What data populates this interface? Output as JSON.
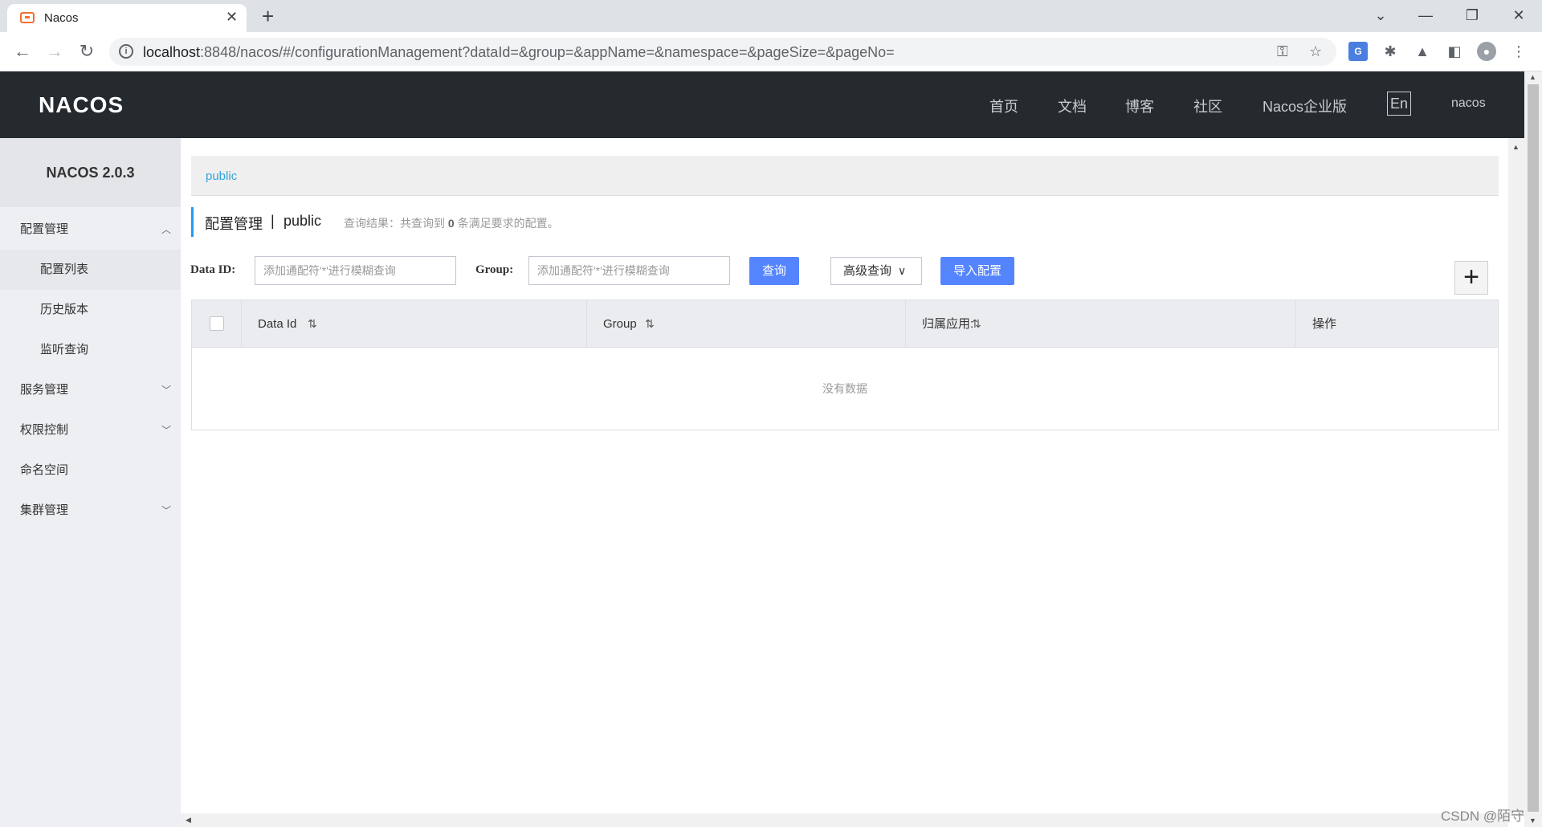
{
  "browser": {
    "tab_title": "Nacos",
    "url_host": "localhost",
    "url_rest": ":8848/nacos/#/configurationManagement?dataId=&group=&appName=&namespace=&pageSize=&pageNo="
  },
  "header": {
    "logo": "NACOS",
    "nav": [
      "首页",
      "文档",
      "博客",
      "社区",
      "Nacos企业版"
    ],
    "lang": "En",
    "user": "nacos"
  },
  "sidebar": {
    "version": "NACOS 2.0.3",
    "items": [
      {
        "label": "配置管理"
      },
      {
        "label": "配置列表"
      },
      {
        "label": "历史版本"
      },
      {
        "label": "监听查询"
      },
      {
        "label": "服务管理"
      },
      {
        "label": "权限控制"
      },
      {
        "label": "命名空间"
      },
      {
        "label": "集群管理"
      }
    ]
  },
  "main": {
    "namespace_tab": "public",
    "title": "配置管理",
    "separator": "|",
    "namespace": "public",
    "query_result_prefix": "查询结果：共查询到",
    "query_result_count": "0",
    "query_result_suffix": "条满足要求的配置。",
    "dataid_label": "Data ID:",
    "dataid_placeholder": "添加通配符'*'进行模糊查询",
    "group_label": "Group:",
    "group_placeholder": "添加通配符'*'进行模糊查询",
    "search_button": "查询",
    "advanced_button": "高级查询",
    "import_button": "导入配置",
    "add_button": "+",
    "table": {
      "columns": [
        "Data Id",
        "Group",
        "归属应用:",
        "操作"
      ],
      "empty_text": "没有数据"
    }
  },
  "watermark": "CSDN @陌守"
}
